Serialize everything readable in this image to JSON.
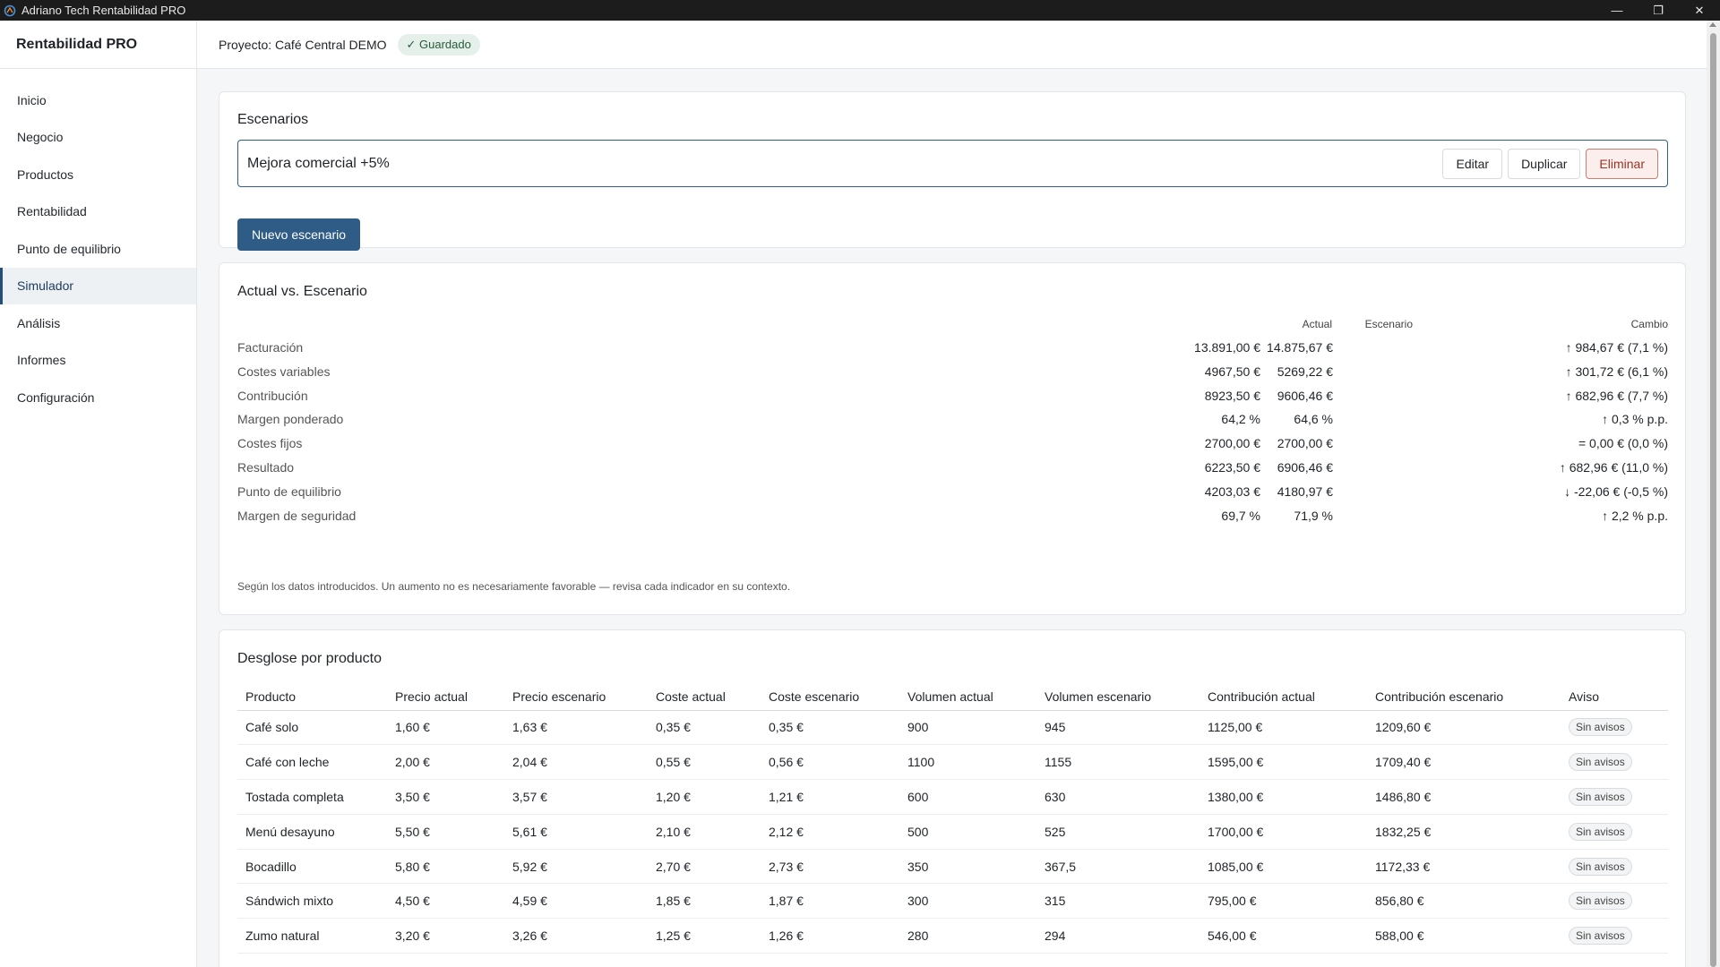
{
  "window": {
    "title": "Adriano Tech Rentabilidad PRO",
    "minimize": "—",
    "maximize": "❐",
    "close": "✕"
  },
  "sidebar": {
    "brand": "Rentabilidad PRO",
    "items": [
      {
        "label": "Inicio"
      },
      {
        "label": "Negocio"
      },
      {
        "label": "Productos"
      },
      {
        "label": "Rentabilidad"
      },
      {
        "label": "Punto de equilibrio"
      },
      {
        "label": "Simulador"
      },
      {
        "label": "Análisis"
      },
      {
        "label": "Informes"
      },
      {
        "label": "Configuración"
      }
    ],
    "active_index": 5
  },
  "header": {
    "project": "Proyecto: Café Central DEMO",
    "saved_badge": "✓ Guardado"
  },
  "scenarios": {
    "title": "Escenarios",
    "current_name": "Mejora comercial +5%",
    "edit_label": "Editar",
    "duplicate_label": "Duplicar",
    "delete_label": "Eliminar",
    "new_label": "Nuevo escenario"
  },
  "comparison": {
    "title": "Actual vs. Escenario",
    "columns": {
      "actual": "Actual",
      "scenario": "Escenario",
      "change": "Cambio"
    },
    "rows": [
      {
        "label": "Facturación",
        "actual": "13.891,00 €",
        "scenario": "14.875,67 €",
        "change": "↑ 984,67 € (7,1 %)"
      },
      {
        "label": "Costes variables",
        "actual": "4967,50 €",
        "scenario": "5269,22 €",
        "change": "↑ 301,72 € (6,1 %)"
      },
      {
        "label": "Contribución",
        "actual": "8923,50 €",
        "scenario": "9606,46 €",
        "change": "↑ 682,96 € (7,7 %)"
      },
      {
        "label": "Margen ponderado",
        "actual": "64,2 %",
        "scenario": "64,6 %",
        "change": "↑ 0,3 % p.p."
      },
      {
        "label": "Costes fijos",
        "actual": "2700,00 €",
        "scenario": "2700,00 €",
        "change": "= 0,00 € (0,0 %)"
      },
      {
        "label": "Resultado",
        "actual": "6223,50 €",
        "scenario": "6906,46 €",
        "change": "↑ 682,96 € (11,0 %)"
      },
      {
        "label": "Punto de equilibrio",
        "actual": "4203,03 €",
        "scenario": "4180,97 €",
        "change": "↓ -22,06 € (-0,5 %)"
      },
      {
        "label": "Margen de seguridad",
        "actual": "69,7 %",
        "scenario": "71,9 %",
        "change": "↑ 2,2 % p.p."
      }
    ],
    "note": "Según los datos introducidos. Un aumento no es necesariamente favorable — revisa cada indicador en su contexto."
  },
  "breakdown": {
    "title": "Desglose por producto",
    "headers": [
      "Producto",
      "Precio actual",
      "Precio escenario",
      "Coste actual",
      "Coste escenario",
      "Volumen actual",
      "Volumen escenario",
      "Contribución actual",
      "Contribución escenario",
      "Aviso"
    ],
    "rows": [
      [
        "Café solo",
        "1,60 €",
        "1,63 €",
        "0,35 €",
        "0,35 €",
        "900",
        "945",
        "1125,00 €",
        "1209,60 €",
        "Sin avisos"
      ],
      [
        "Café con leche",
        "2,00 €",
        "2,04 €",
        "0,55 €",
        "0,56 €",
        "1100",
        "1155",
        "1595,00 €",
        "1709,40 €",
        "Sin avisos"
      ],
      [
        "Tostada completa",
        "3,50 €",
        "3,57 €",
        "1,20 €",
        "1,21 €",
        "600",
        "630",
        "1380,00 €",
        "1486,80 €",
        "Sin avisos"
      ],
      [
        "Menú desayuno",
        "5,50 €",
        "5,61 €",
        "2,10 €",
        "2,12 €",
        "500",
        "525",
        "1700,00 €",
        "1832,25 €",
        "Sin avisos"
      ],
      [
        "Bocadillo",
        "5,80 €",
        "5,92 €",
        "2,70 €",
        "2,73 €",
        "350",
        "367,5",
        "1085,00 €",
        "1172,33 €",
        "Sin avisos"
      ],
      [
        "Sándwich mixto",
        "4,50 €",
        "4,59 €",
        "1,85 €",
        "1,87 €",
        "300",
        "315",
        "795,00 €",
        "856,80 €",
        "Sin avisos"
      ],
      [
        "Zumo natural",
        "3,20 €",
        "3,26 €",
        "1,25 €",
        "1,26 €",
        "280",
        "294",
        "546,00 €",
        "588,00 €",
        "Sin avisos"
      ]
    ]
  }
}
